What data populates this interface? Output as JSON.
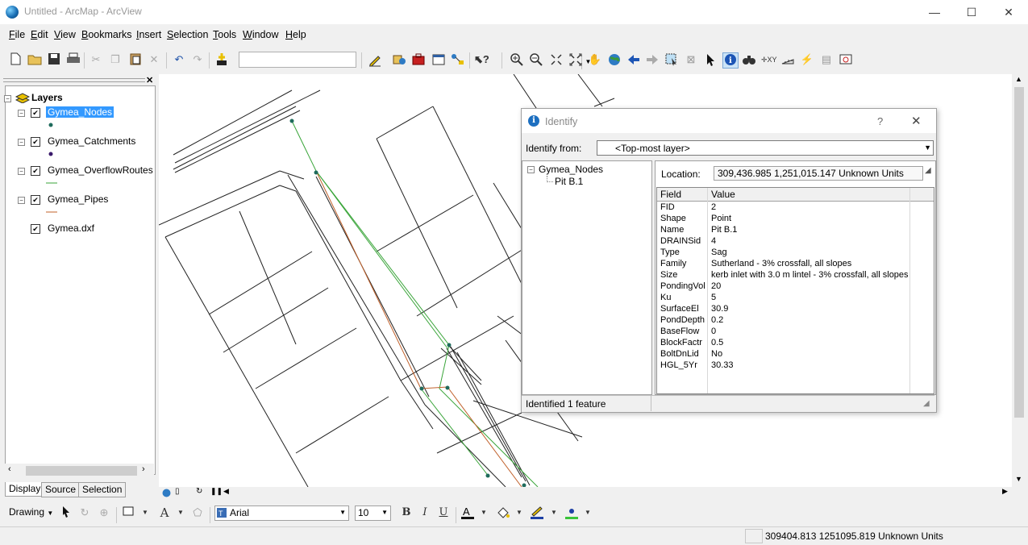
{
  "window": {
    "title": "Untitled - ArcMap - ArcView",
    "minimize_glyph": "—",
    "maximize_glyph": "☐",
    "close_glyph": "✕"
  },
  "menubar": {
    "items": [
      {
        "label": "File",
        "accel": "F",
        "rest": "ile"
      },
      {
        "label": "Edit",
        "accel": "E",
        "rest": "dit"
      },
      {
        "label": "View",
        "accel": "V",
        "rest": "iew"
      },
      {
        "label": "Bookmarks",
        "accel": "B",
        "rest": "ookmarks"
      },
      {
        "label": "Insert",
        "accel": "I",
        "rest": "nsert"
      },
      {
        "label": "Selection",
        "accel": "S",
        "rest": "election"
      },
      {
        "label": "Tools",
        "accel": "T",
        "rest": "ools"
      },
      {
        "label": "Window",
        "accel": "W",
        "rest": "indow"
      },
      {
        "label": "Help",
        "accel": "H",
        "rest": "elp"
      }
    ]
  },
  "toolbar": {
    "icons": [
      "new-document-icon",
      "open-folder-icon",
      "save-icon",
      "print-icon",
      "cut-icon",
      "copy-icon",
      "paste-icon",
      "delete-icon",
      "undo-icon",
      "redo-icon",
      "add-data-icon",
      "scale-dropdown",
      "editor-toolbar-icon",
      "arccatalog-icon",
      "arctoolbox-icon",
      "command-line-icon",
      "modelbuilder-icon",
      "whats-this-icon",
      "zoom-in-icon",
      "zoom-out-icon",
      "fixed-zoom-in-icon",
      "fixed-zoom-out-icon",
      "pan-icon",
      "full-extent-icon",
      "back-extent-icon",
      "forward-extent-icon",
      "select-by-rectangle-icon",
      "clear-selection-icon",
      "select-elements-icon",
      "identify-icon",
      "find-icon",
      "go-to-xy-icon",
      "measure-icon",
      "hyperlink-icon",
      "html-popup-icon",
      "time-slider-icon"
    ],
    "scale_value": ""
  },
  "toc": {
    "root_label": "Layers",
    "layers": [
      {
        "name": "Gymea_Nodes",
        "checked": true,
        "selected": true,
        "symbol": "point",
        "color": "#1f6b5c"
      },
      {
        "name": "Gymea_Catchments",
        "checked": true,
        "selected": false,
        "symbol": "point",
        "color": "#3a1a6b"
      },
      {
        "name": "Gymea_OverflowRoutes",
        "checked": true,
        "selected": false,
        "symbol": "line",
        "color": "#3aa53a"
      },
      {
        "name": "Gymea_Pipes",
        "checked": true,
        "selected": false,
        "symbol": "line",
        "color": "#c0602a"
      },
      {
        "name": "Gymea.dxf",
        "checked": true,
        "selected": false,
        "symbol": "none",
        "color": ""
      }
    ],
    "tabs": [
      "Display",
      "Source",
      "Selection"
    ],
    "close_glyph": "✕"
  },
  "identify": {
    "title": "Identify",
    "help_glyph": "?",
    "close_glyph": "✕",
    "from_label": "Identify from:",
    "from_value": "<Top-most layer>",
    "tree": {
      "layer": "Gymea_Nodes",
      "feature": "Pit B.1"
    },
    "location_label": "Location:",
    "location_value": "309,436.985  1,251,015.147 Unknown Units",
    "grid_headers": {
      "field": "Field",
      "value": "Value"
    },
    "rows": [
      {
        "field": "FID",
        "value": "2"
      },
      {
        "field": "Shape",
        "value": "Point"
      },
      {
        "field": "Name",
        "value": "Pit B.1"
      },
      {
        "field": "DRAINSid",
        "value": "4"
      },
      {
        "field": "Type",
        "value": "Sag"
      },
      {
        "field": "Family",
        "value": "Sutherland - 3% crossfall, all slopes"
      },
      {
        "field": "Size",
        "value": "kerb inlet with 3.0 m lintel - 3% crossfall, all slopes"
      },
      {
        "field": "PondingVol",
        "value": "20"
      },
      {
        "field": "Ku",
        "value": "5"
      },
      {
        "field": "SurfaceEl",
        "value": "30.9"
      },
      {
        "field": "PondDepth",
        "value": "0.2"
      },
      {
        "field": "BaseFlow",
        "value": "0"
      },
      {
        "field": "BlockFactr",
        "value": "0.5"
      },
      {
        "field": "BoltDnLid",
        "value": "No"
      },
      {
        "field": "HGL_5Yr",
        "value": "30.33"
      }
    ],
    "status": "Identified 1 feature"
  },
  "drawing_toolbar": {
    "drawing_label": "Drawing",
    "font_name": "Arial",
    "font_size": "10",
    "bold": "B",
    "italic": "I",
    "underline": "U",
    "text_tool": "A"
  },
  "statusbar": {
    "coords": "309404.813  1251095.819 Unknown Units"
  }
}
